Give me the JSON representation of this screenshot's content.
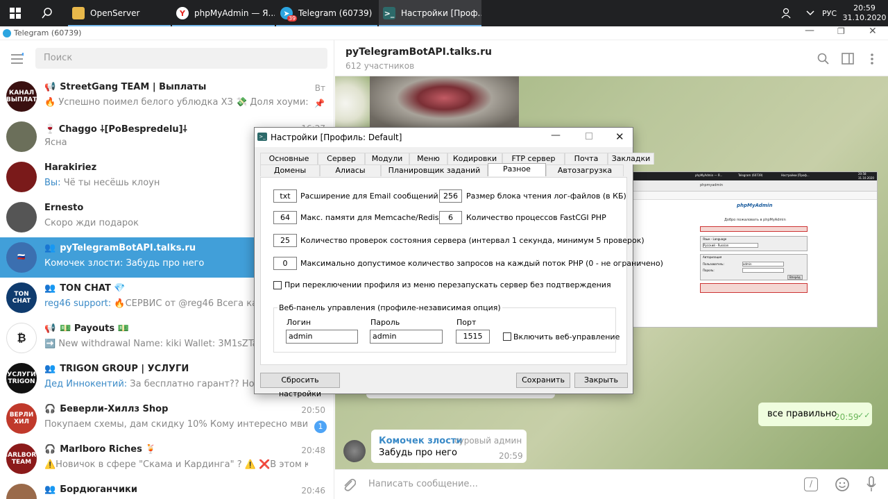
{
  "taskbar": {
    "tasks": [
      {
        "label": "OpenServer",
        "icon": "folder-icon"
      },
      {
        "label": "phpMyAdmin — Я...",
        "icon": "yandex-browser-icon"
      },
      {
        "label": "Telegram (60739)",
        "icon": "telegram-icon",
        "badge": "39"
      },
      {
        "label": "Настройки [Проф...",
        "icon": "openserver-icon"
      }
    ],
    "lang": "РУС",
    "time": "20:59",
    "date": "31.10.2020"
  },
  "tg": {
    "window_title": "Telegram (60739)",
    "search_placeholder": "Поиск",
    "chats": [
      {
        "name": "StreetGang TEAM | Выплаты",
        "kind": "📢",
        "msg": "🔥 Успешно поимел белого ублюдка ХЗ 💸 Доля хоуми: 600 R...",
        "time": "Вт",
        "pinned": true,
        "avatar_color": "#3a1010",
        "avatar_text": "КАНАЛ ВЫПЛАТ"
      },
      {
        "name": "🍷 Ϲhaggo ⸸[PoBespredelu]⸸",
        "kind": "",
        "msg": "Ясна",
        "time": "16:27",
        "avatar_color": "#6b6f5a",
        "avatar_text": ""
      },
      {
        "name": "Harakiriez",
        "kind": "",
        "msg": "Чё ты несёшь клоун",
        "sender": "Вы: ",
        "time": "",
        "avatar_color": "#7a1a1a",
        "avatar_text": ""
      },
      {
        "name": "Ernesto",
        "kind": "",
        "msg": "Скоро жди подарок",
        "time": "",
        "avatar_color": "#555555",
        "avatar_text": ""
      },
      {
        "name": "pyTelegramBotAPI.talks.ru",
        "kind": "👥",
        "msg": "Забудь про него",
        "sender": "Комочек злости: ",
        "time": "",
        "selected": true,
        "avatar_color": "#3b6fb0",
        "avatar_text": "🇷🇺"
      },
      {
        "name": "TON CHAT 💎",
        "kind": "👥",
        "msg": "🔥СЕРВИС от @reg46   Всега качестве...",
        "sender": "reg46 support: ",
        "time": "",
        "avatar_color": "#0f3b6e",
        "avatar_text": "TON CHAT"
      },
      {
        "name": "💵 Payouts 💵",
        "kind": "📢",
        "msg": "➡️ New withdrawal Name: kiki  Wallet: 3M1sZTa1BcPM...",
        "time": "",
        "avatar_color": "#ffffff",
        "avatar_text": "₿"
      },
      {
        "name": "TRIGON GROUP | УСЛУГИ",
        "kind": "👥",
        "msg": "За бесплатно гарант?? Новорега на...",
        "sender": "Дед Иннокентий: ",
        "time": "",
        "avatar_color": "#111111",
        "avatar_text": "УСЛУГИ TRIGON"
      },
      {
        "name": "Беверли-Хиллз Shop",
        "kind": "🎧",
        "msg": "Покупаем схемы, дам скидку 10% Кому интересно мвидео балл...",
        "time": "20:50",
        "unread": "1",
        "avatar_color": "#c0392b",
        "avatar_text": "ВЕРЛИ ХИЛ"
      },
      {
        "name": "Marlboro Riches 🍹",
        "kind": "🎧",
        "msg": "⚠️Новичок в сфере \"Скама и Кардинга\" ? ⚠️ ❌В этом канале мы т...",
        "time": "20:48",
        "avatar_color": "#8b1a1a",
        "avatar_text": "MARLBORO TEAM"
      },
      {
        "name": "Бордюганчики",
        "kind": "👥",
        "msg": "",
        "time": "20:46",
        "avatar_color": "#9a6a4a",
        "avatar_text": ""
      }
    ],
    "header_title": "pyTelegramBotAPI.talks.ru",
    "header_subtitle": "612 участников",
    "composer_placeholder": "Написать сообщение...",
    "outgoing": {
      "text": "все правильно",
      "time": "20:59"
    },
    "incoming": {
      "sender": "Комочек злости",
      "role": "суровый админ",
      "text": "Забудь про него",
      "time": "20:59"
    }
  },
  "dialog": {
    "title": "Настройки [Профиль: Default]",
    "tabs_row1": [
      "Основные",
      "Сервер",
      "Модули",
      "Меню",
      "Кодировки",
      "FTP сервер",
      "Почта",
      "Закладки"
    ],
    "tabs_row2": [
      "Домены",
      "Алиасы",
      "Планировщик заданий",
      "Разное",
      "Автозагрузка"
    ],
    "active_tab": "Разное",
    "email_ext": {
      "value": "txt",
      "label": "Расширение для Email сообщений"
    },
    "log_block": {
      "value": "256",
      "label": "Размер блока чтения лог-файлов (в КБ)"
    },
    "memcache": {
      "value": "64",
      "label": "Макс. памяти для Memcache/Redis (МБ)"
    },
    "fastcgi": {
      "value": "6",
      "label": "Количество процессов FastCGI PHP"
    },
    "health": {
      "value": "25",
      "label": "Количество проверок состояния сервера (интервал 1 секунда, минимум 5 проверок)"
    },
    "maxreq": {
      "value": "0",
      "label": "Максимально допустимое количество запросов на каждый поток PHP (0 - не ограничено)"
    },
    "restart_cb": "При переключении профиля из меню перезапускать сервер без подтверждения",
    "web_group": "Веб-панель управления (профиле-независимая опция)",
    "login_label": "Логин",
    "login_value": "admin",
    "password_label": "Пароль",
    "password_value": "admin",
    "port_label": "Порт",
    "port_value": "1515",
    "web_cb": "Включить веб-управление",
    "reset_btn": "Сбросить настройки",
    "save_btn": "Сохранить",
    "close_btn": "Закрыть"
  },
  "shot": {
    "tab1": "phpMyAdmin — Я...",
    "tab2": "Telegram (60739)",
    "tab3": "Настройки [Проф...",
    "url": "phpmyadmin",
    "welcome": "Добро пожаловать в phpMyAdmin",
    "brand": "phpMyAdmin",
    "lang_label": "Язык - Language",
    "lang_value": "Русский - Russian",
    "auth_label": "Авторизация",
    "user_label": "Пользователь:",
    "user_value": "admin",
    "pass_label": "Пароль:",
    "go": "Вперёд",
    "time": "20:58",
    "date": "31.10.2020"
  }
}
